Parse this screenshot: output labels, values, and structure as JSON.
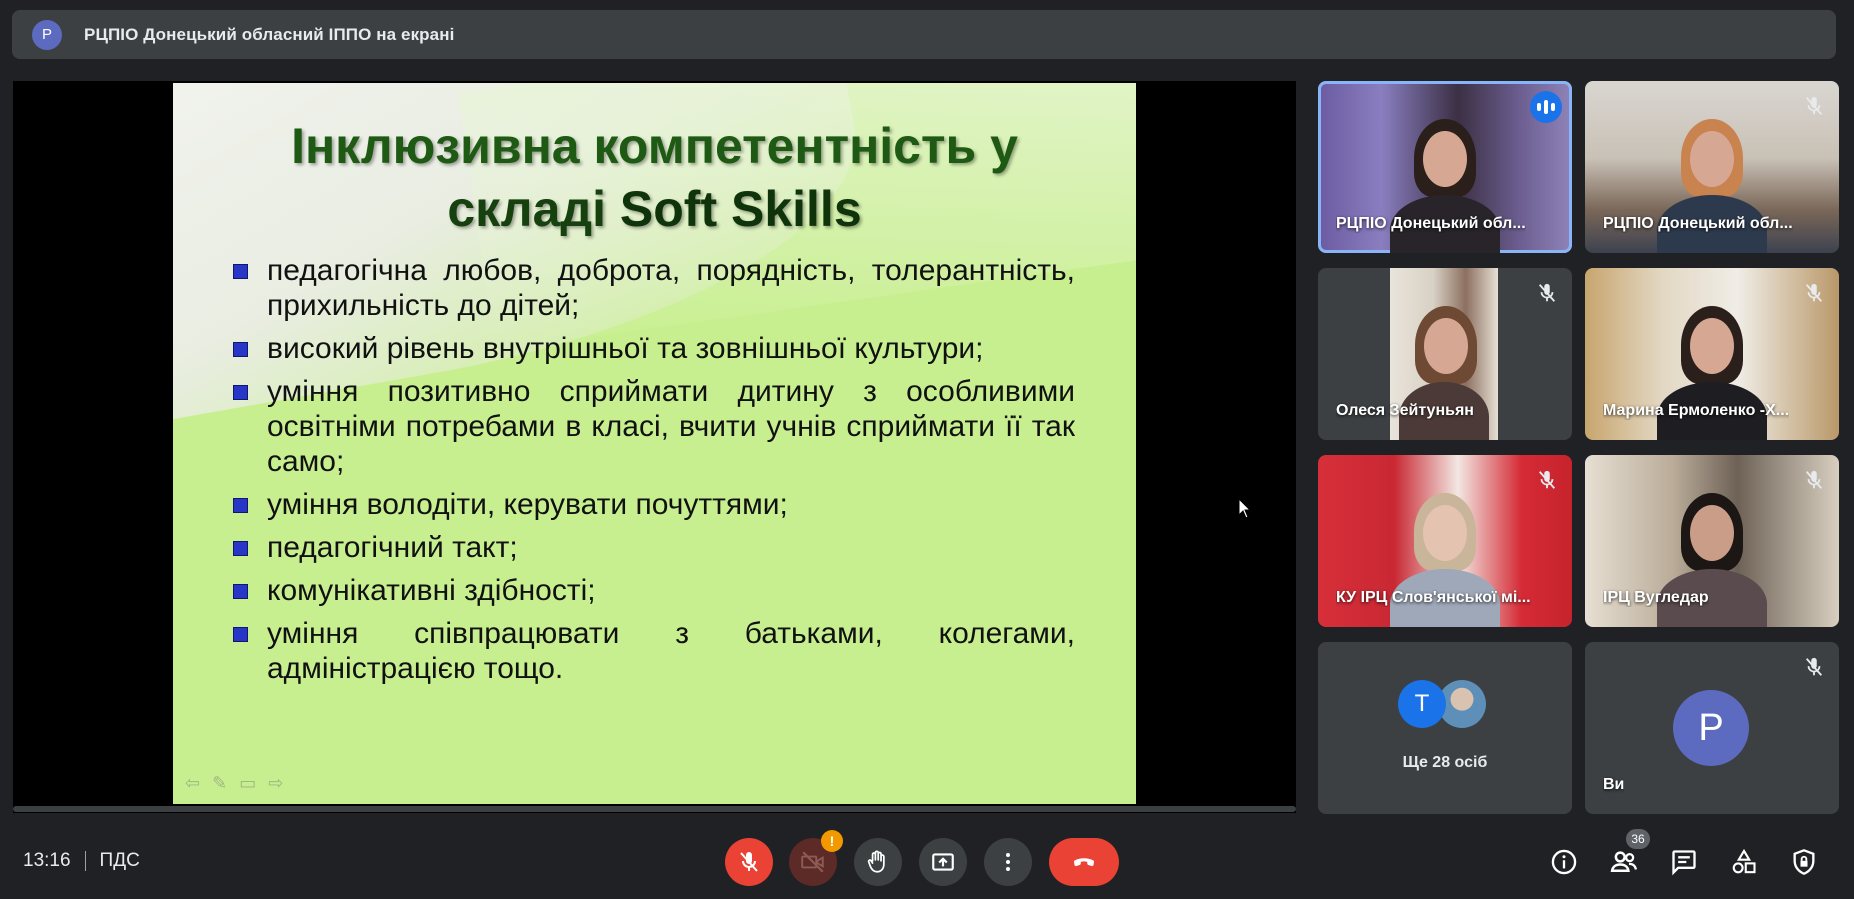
{
  "banner": {
    "avatar_letter": "Р",
    "text": "РЦПІО Донецький обласний ІППО на екрані"
  },
  "slide": {
    "title_line1": "Інклюзивна компетентність у",
    "title_line2_prefix": "складі ",
    "title_line2_bold": "Soft Skills",
    "bullets": [
      "педагогічна любов, доброта, порядність, толерантність, прихильність до дітей;",
      "високий рівень внутрішньої та зовнішньої культури;",
      "уміння позитивно сприймати дитину з особливими освітніми потребами в класі, вчити учнів сприймати її так само;",
      "уміння володіти, керувати почуттями;",
      "педагогічний такт;",
      "комунікативні здібності;",
      "уміння співпрацювати з батьками, колегами, адміністрацією тощо."
    ]
  },
  "tiles": [
    {
      "name": "РЦПІО Донецький обл...",
      "state": "speaking"
    },
    {
      "name": "РЦПІО Донецький обл...",
      "state": "muted"
    },
    {
      "name": "Олеся Зейтуньян",
      "state": "muted"
    },
    {
      "name": "Марина Ермоленко -Х...",
      "state": "muted"
    },
    {
      "name": "КУ ІРЦ Слов'янської мі...",
      "state": "muted"
    },
    {
      "name": "ІРЦ Вугледар",
      "state": "muted"
    }
  ],
  "more": {
    "avatar_letter": "T",
    "label": "Ще 28 осіб"
  },
  "self": {
    "avatar_letter": "Р",
    "label": "Ви"
  },
  "bottom": {
    "time": "13:16",
    "meeting_code": "ПДС",
    "camera_warning": "!",
    "participants_count": "36"
  },
  "colors": {
    "accent_blue": "#1a73e8",
    "danger_red": "#ea4335",
    "warning": "#f29900",
    "slide_bg": "#c8ef8f"
  },
  "icons": [
    "mic-off-icon",
    "camera-off-icon",
    "raise-hand-icon",
    "present-icon",
    "more-options-icon",
    "hang-up-icon",
    "info-icon",
    "people-icon",
    "chat-icon",
    "activities-icon",
    "host-controls-icon"
  ]
}
